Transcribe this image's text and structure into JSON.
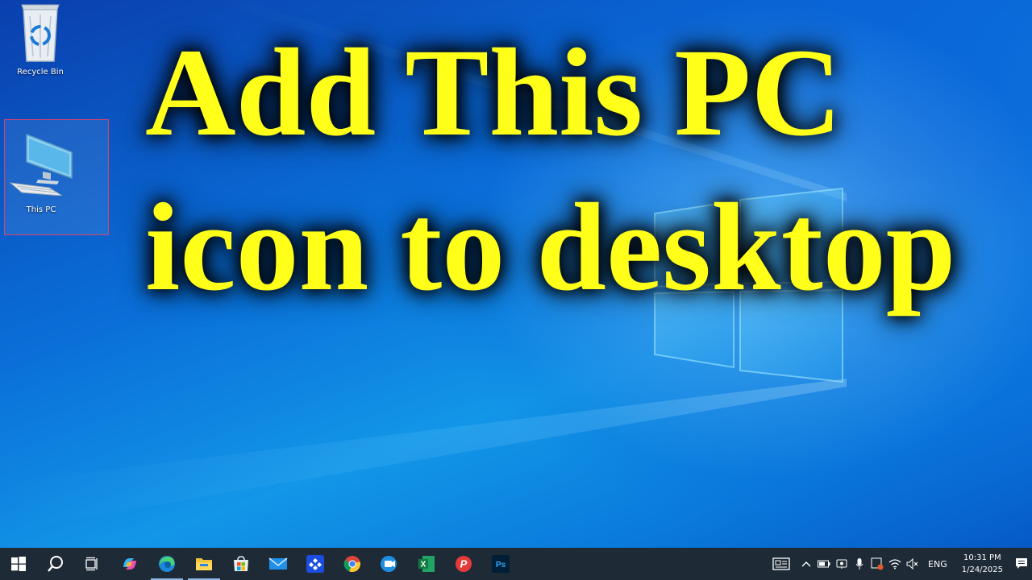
{
  "desktop": {
    "icons": [
      {
        "label": "Recycle Bin",
        "icon": "recycle-bin-icon"
      },
      {
        "label": "This PC",
        "icon": "this-pc-icon"
      }
    ],
    "headline": {
      "line1": "Add This PC",
      "line2": "icon to desktop"
    }
  },
  "taskbar": {
    "apps": [
      {
        "name": "start-icon"
      },
      {
        "name": "search-icon"
      },
      {
        "name": "task-view-icon"
      },
      {
        "name": "copilot-icon"
      },
      {
        "name": "edge-icon"
      },
      {
        "name": "file-explorer-icon"
      },
      {
        "name": "microsoft-store-icon"
      },
      {
        "name": "mail-icon"
      },
      {
        "name": "app-icon"
      },
      {
        "name": "chrome-icon"
      },
      {
        "name": "camera-app-icon"
      },
      {
        "name": "excel-icon",
        "letter": "X"
      },
      {
        "name": "psiphon-icon",
        "letter": "P"
      },
      {
        "name": "photoshop-icon",
        "letter": "Ps"
      }
    ],
    "tray": {
      "language": "ENG",
      "time": "10:31 PM",
      "date": "1/24/2025"
    }
  },
  "colors": {
    "headline": "#ffff1a",
    "taskbar": "#1e2a36",
    "selection_border": "#d9446e"
  }
}
